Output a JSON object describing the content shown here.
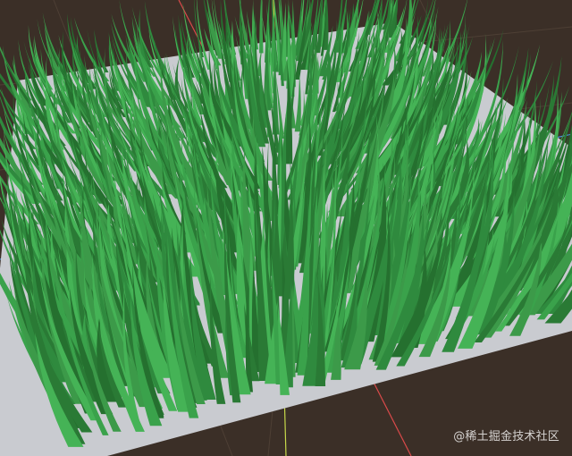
{
  "viewport": {
    "background_color": "#3b2f27",
    "grid_color": "#5a4a3e",
    "axis_colors": {
      "x": "#d94a4a",
      "y": "#c7d94a",
      "z": "#4a8fd9"
    }
  },
  "scene": {
    "ground_plane_color": "#c9cbd0",
    "grass_colors": [
      "#2f8a3e",
      "#3aa24b",
      "#2a7a35",
      "#45b356",
      "#25702f",
      "#3c9a49"
    ],
    "object": "grass-field"
  },
  "watermark": {
    "text": "@稀土掘金技术社区"
  }
}
